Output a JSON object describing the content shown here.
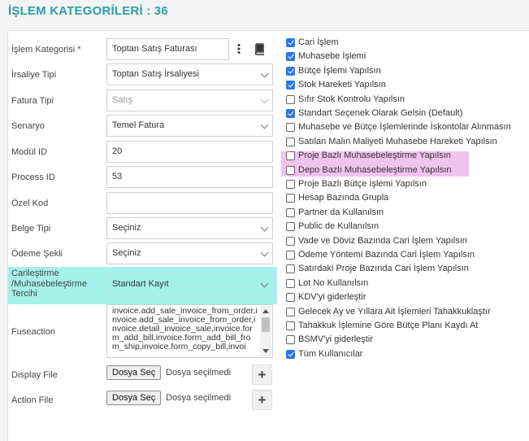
{
  "title": "İŞLEM KATEGORİLERİ : 36",
  "form": {
    "islem_kategorisi": {
      "label": "İşlem Kategorisi *",
      "value": "Toptan Satış Faturası"
    },
    "irsaliye_tipi": {
      "label": "İrsaliye Tipi",
      "value": "Toptan Satış İrsaliyesi"
    },
    "fatura_tipi": {
      "label": "Fatura Tipi",
      "value": "Satış"
    },
    "senaryo": {
      "label": "Senaryo",
      "value": "Temel Fatura"
    },
    "modul_id": {
      "label": "Modül ID",
      "value": "20"
    },
    "process_id": {
      "label": "Process ID",
      "value": "53"
    },
    "ozel_kod": {
      "label": "Özel Kod",
      "value": ""
    },
    "belge_tipi": {
      "label": "Belge Tipi",
      "value": "Seçiniz"
    },
    "odeme_sekli": {
      "label": "Ödeme Şekli",
      "value": "Seçiniz"
    },
    "carilestirme": {
      "label_line1": "Carileştirme",
      "label_line2": "/Muhasebeleştirme",
      "label_line3": "Tercihi",
      "value": "Standart Kayıt"
    },
    "fuseaction": {
      "label": "Fuseaction",
      "value": "invoice.add_sale_invoice_from_order,invoice.add_sale_invoice_from_order,invoice.detail_invoice_sale,invoice.form_add_bill,invoice.form_add_bill_from_ship,invoice.form_copy_bill,invoi"
    },
    "display_file": {
      "label": "Display File",
      "button": "Dosya Seç",
      "status": "Dosya seçilmedi"
    },
    "action_file": {
      "label": "Action File",
      "button": "Dosya Seç",
      "status": "Dosya seçilmedi"
    }
  },
  "checkboxes": [
    {
      "label": "Cari İşlem",
      "checked": true
    },
    {
      "label": "Muhasebe İşlemi",
      "checked": true
    },
    {
      "label": "Bütçe İşlemi Yapılsın",
      "checked": true
    },
    {
      "label": "Stok Hareketi Yapılsın",
      "checked": true
    },
    {
      "label": "Sıfır Stok Kontrolu Yapılsın",
      "checked": false
    },
    {
      "label": "Standart Seçenek Olarak Gelsin (Default)",
      "checked": true
    },
    {
      "label": "Muhasebe ve Bütçe İşlemlerinde İskontolar Alınmasın",
      "checked": false
    },
    {
      "label": "Satılan Malın Maliyeti Muhasebe Hareketi Yapılsın",
      "checked": false
    },
    {
      "label": "Proje Bazlı Muhasebeleştirme Yapılsın",
      "checked": false
    },
    {
      "label": "Depo Bazlı Muhasebeleştirme Yapılsın",
      "checked": false
    },
    {
      "label": "Proje Bazlı Bütçe İşlemi Yapılsın",
      "checked": false
    },
    {
      "label": "Hesap Bazında Grupla",
      "checked": false
    },
    {
      "label": "Partner da Kullanılsın",
      "checked": false
    },
    {
      "label": "Public de Kullanılsın",
      "checked": false
    },
    {
      "label": "Vade ve Döviz Bazında Cari İşlem Yapılsın",
      "checked": false
    },
    {
      "label": "Ödeme Yöntemi Bazında Cari İşlem Yapılsın",
      "checked": false
    },
    {
      "label": "Satırdaki Proje Bazında Cari İşlem Yapılsın",
      "checked": false
    },
    {
      "label": "Lot No Kullanılsın",
      "checked": false
    },
    {
      "label": "KDV'yi giderleştir",
      "checked": false
    },
    {
      "label": "Gelecek Ay ve Yıllara Ait İşlemleri Tahakkuklaştır",
      "checked": false
    },
    {
      "label": "Tahakkuk İşlemine Göre Bütçe Planı Kaydı At",
      "checked": false
    },
    {
      "label": "BSMV'yi giderleştir",
      "checked": false
    },
    {
      "label": "Tüm Kullanıcılar",
      "checked": true
    }
  ],
  "icons": {
    "menu": "vertical-dots-icon",
    "book": "book-icon",
    "add": "plus-icon"
  },
  "colors": {
    "title": "#2a9fa8",
    "checkbox": "#2b78e4",
    "highlight_teal": "#a6f0ec",
    "highlight_pink": "#f1c3ef"
  }
}
